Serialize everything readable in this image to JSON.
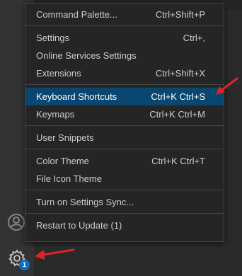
{
  "menu": {
    "groups": [
      [
        {
          "label": "Command Palette...",
          "shortcut": "Ctrl+Shift+P"
        }
      ],
      [
        {
          "label": "Settings",
          "shortcut": "Ctrl+,"
        },
        {
          "label": "Online Services Settings",
          "shortcut": ""
        },
        {
          "label": "Extensions",
          "shortcut": "Ctrl+Shift+X"
        }
      ],
      [
        {
          "label": "Keyboard Shortcuts",
          "shortcut": "Ctrl+K Ctrl+S"
        },
        {
          "label": "Keymaps",
          "shortcut": "Ctrl+K Ctrl+M"
        }
      ],
      [
        {
          "label": "User Snippets",
          "shortcut": ""
        }
      ],
      [
        {
          "label": "Color Theme",
          "shortcut": "Ctrl+K Ctrl+T"
        },
        {
          "label": "File Icon Theme",
          "shortcut": ""
        }
      ],
      [
        {
          "label": "Turn on Settings Sync...",
          "shortcut": ""
        }
      ],
      [
        {
          "label": "Restart to Update (1)",
          "shortcut": ""
        }
      ]
    ]
  },
  "activity_bar": {
    "gear_badge_count": "1"
  },
  "colors": {
    "highlight": "#094771",
    "badge": "#0e70c0",
    "arrow": "#e02424"
  }
}
